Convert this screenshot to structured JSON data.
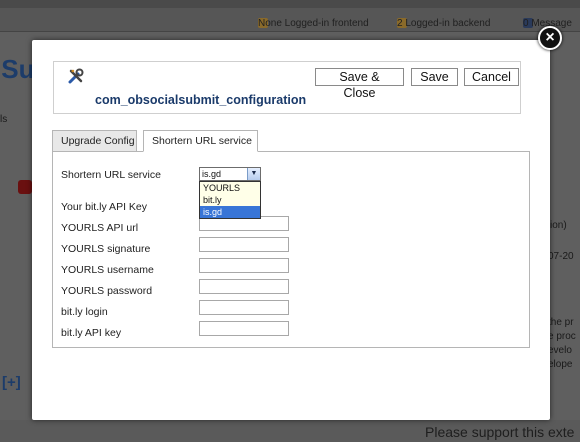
{
  "background": {
    "status_none_frontend": "None Logged-in frontend",
    "status_backend": "2 Logged-in backend",
    "status_messages": "0 Message",
    "bottom_text": "Please support this exte"
  },
  "dialog": {
    "component_title": "com_obsocialsubmit_configuration",
    "buttons": {
      "save_close": "Save & Close",
      "save": "Save",
      "cancel": "Cancel"
    },
    "tabs": [
      {
        "label": "Upgrade Config",
        "active": false
      },
      {
        "label": "Shortern URL service",
        "active": true
      }
    ],
    "form": {
      "shortener_label": "Shortern URL service",
      "shortener_selected": "is.gd",
      "shortener_options": [
        "YOURLS",
        "bit.ly",
        "is.gd"
      ],
      "highlighted_option": "is.gd",
      "fields": [
        {
          "label": "Your bit.ly API Key",
          "value": ""
        },
        {
          "label": "YOURLS API url",
          "value": ""
        },
        {
          "label": "YOURLS signature",
          "value": ""
        },
        {
          "label": "YOURLS username",
          "value": ""
        },
        {
          "label": "YOURLS password",
          "value": ""
        },
        {
          "label": "bit.ly login",
          "value": ""
        },
        {
          "label": "bit.ly API key",
          "value": ""
        }
      ]
    }
  },
  "icons": {
    "tool": "wrench-screwdriver-icon",
    "close": "close-icon",
    "dropdown_arrow": "chevron-down-icon"
  },
  "colors": {
    "title_blue": "#1a3a6a",
    "selection_blue": "#3875d7",
    "dropdown_bg": "#ffffe8",
    "overlay": "#5f5f5f"
  }
}
